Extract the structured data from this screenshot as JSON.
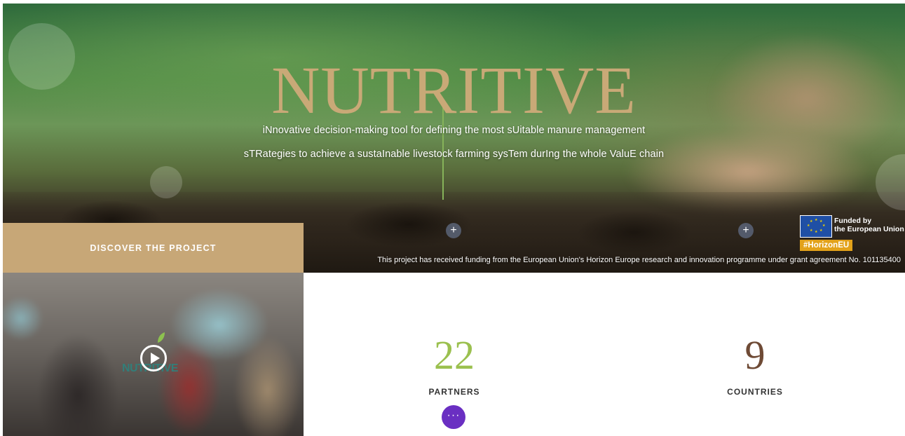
{
  "hero": {
    "title": "NUTRITIVE",
    "subtitle_line1": "iNnovative decision-making tool for defining the most sUitable manure management",
    "subtitle_line2": "sTRategies to achieve a sustaInable livestock farming sysTem durIng the whole ValuE chain",
    "expand_icon": "+",
    "funding_note": "This project has received funding from the European Union's Horizon Europe research and innovation programme under grant agreement No. 101135400",
    "eu_badge": {
      "line1": "Funded by",
      "line2": "the European Union",
      "tag": "#HorizonEU"
    }
  },
  "discover": {
    "label": "DISCOVER THE PROJECT"
  },
  "video": {
    "logo_text": "NUTRITIVE",
    "icon": "play-icon"
  },
  "stats": [
    {
      "value": "22",
      "label": "PARTNERS",
      "color": "#9bc04f"
    },
    {
      "value": "9",
      "label": "COUNTRIES",
      "color": "#6e4a35"
    }
  ],
  "fab": {
    "label": "···",
    "color": "#6a2fc2"
  }
}
